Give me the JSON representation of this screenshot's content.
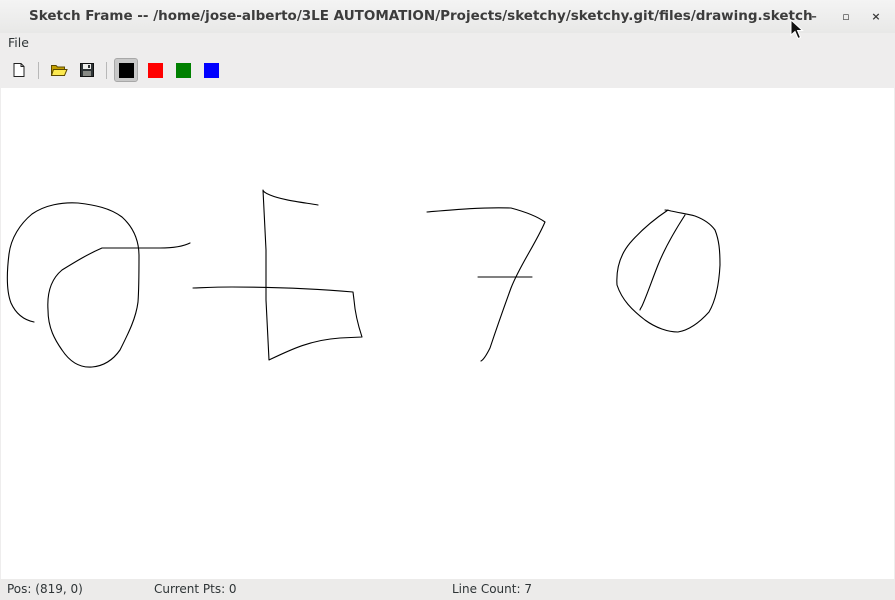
{
  "window": {
    "title": "Sketch Frame -- /home/jose-alberto/3LE AUTOMATION/Projects/sketchy/sketchy.git/files/drawing.sketch",
    "minimize_glyph": "–",
    "maximize_glyph": "▫",
    "close_glyph": "×"
  },
  "menubar": {
    "items": [
      {
        "label": "File"
      }
    ]
  },
  "toolbar": {
    "buttons": [
      {
        "name": "new-document",
        "icon": "new-document-icon"
      },
      {
        "name": "open",
        "icon": "open-folder-icon"
      },
      {
        "name": "save",
        "icon": "save-disk-icon"
      }
    ],
    "colors": [
      {
        "name": "black",
        "hex": "#000000",
        "selected": true
      },
      {
        "name": "red",
        "hex": "#ff0000",
        "selected": false
      },
      {
        "name": "green",
        "hex": "#008000",
        "selected": false
      },
      {
        "name": "blue",
        "hex": "#0000ff",
        "selected": false
      }
    ]
  },
  "status": {
    "pos": "Pos: (819, 0)",
    "current_pts": "Current Pts: 0",
    "line_count": "Line Count: 7"
  }
}
